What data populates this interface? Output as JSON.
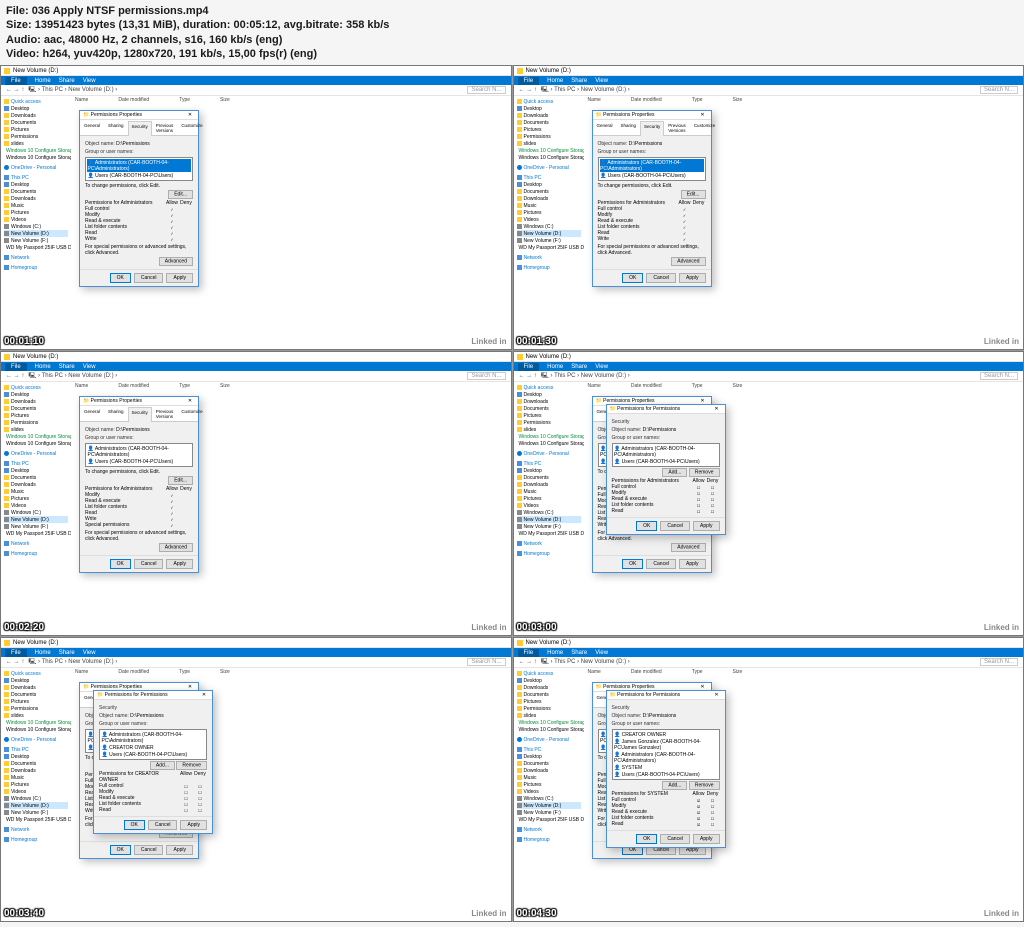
{
  "header": {
    "file_label": "File:",
    "file": "036 Apply NTSF permissions.mp4",
    "size_label": "Size:",
    "size": "13951423 bytes (13,31 MiB),",
    "dur_label": "duration:",
    "duration": "00:05:12,",
    "br_label": "avg.bitrate:",
    "bitrate": "358 kb/s",
    "audio_label": "Audio:",
    "audio": "aac, 48000 Hz, 2 channels, s16, 160 kb/s (eng)",
    "video_label": "Video:",
    "video": "h264, yuv420p, 1280x720, 191 kb/s, 15,00 fps(r) (eng)"
  },
  "explorer": {
    "title": "New Volume (D:)",
    "toolbar": {
      "file": "File",
      "home": "Home",
      "share": "Share",
      "view": "View"
    },
    "path": {
      "prefix": "This PC",
      "loc": "New Volume (D:)",
      "search": "Search N..."
    },
    "cols": {
      "name": "Name",
      "modified": "Date modified",
      "type": "Type",
      "size": "Size"
    },
    "sidebar": [
      {
        "t": "Quick access",
        "c": "blue"
      },
      {
        "t": "Desktop"
      },
      {
        "t": "Downloads"
      },
      {
        "t": "Documents"
      },
      {
        "t": "Pictures"
      },
      {
        "t": "Permissions",
        "c": ""
      },
      {
        "t": "slides"
      },
      {
        "t": "Windows 10 Configure Storage",
        "c": "green"
      },
      {
        "t": "Windows 10 Configure Storage"
      },
      {
        "t": ""
      },
      {
        "t": "OneDrive - Personal",
        "c": "blue"
      },
      {
        "t": ""
      },
      {
        "t": "This PC",
        "c": "blue"
      },
      {
        "t": "Desktop"
      },
      {
        "t": "Documents"
      },
      {
        "t": "Downloads"
      },
      {
        "t": "Music"
      },
      {
        "t": "Pictures"
      },
      {
        "t": "Videos"
      },
      {
        "t": "Windows (C:)"
      },
      {
        "t": "New Volume (D:)",
        "sel": true
      },
      {
        "t": "New Volume (F:)"
      },
      {
        "t": "WD My Passport 25IF USB Device (G:)"
      },
      {
        "t": ""
      },
      {
        "t": "Network",
        "c": "blue"
      },
      {
        "t": ""
      },
      {
        "t": "Homegroup",
        "c": "blue"
      }
    ]
  },
  "propsDialog": {
    "title": "Permissions Properties",
    "tabs": [
      "General",
      "Sharing",
      "Security",
      "Previous Versions",
      "Customize"
    ],
    "objname_l": "Object name:",
    "objname": "D:\\Permissions",
    "group_l": "Group or user names:",
    "users": [
      "Administrators (CAR-BOOTH-04-PC\\Administrators)",
      "Users (CAR-BOOTH-04-PC\\Users)"
    ],
    "change_l": "To change permissions, click Edit.",
    "edit": "Edit...",
    "perms_l": "Permissions for Administrators",
    "allow": "Allow",
    "deny": "Deny",
    "perms1": [
      "Full control",
      "Modify",
      "Read & execute",
      "List folder contents",
      "Read",
      "Write"
    ],
    "perms2": [
      "Modify",
      "Read & execute",
      "List folder contents",
      "Read",
      "Write",
      "Special permissions"
    ],
    "adv_l": "For special permissions or advanced settings, click Advanced.",
    "adv": "Advanced",
    "ok": "OK",
    "cancel": "Cancel",
    "apply": "Apply"
  },
  "permForDialog": {
    "title": "Permissions for Permissions",
    "sec": "Security",
    "objname_l": "Object name:",
    "objname": "D:\\Permissions",
    "group_l": "Group or user names:",
    "users4": [
      "Administrators (CAR-BOOTH-04-PC\\Administrators)",
      "Users (CAR-BOOTH-04-PC\\Users)"
    ],
    "users5": [
      "Administrators (CAR-BOOTH-04-PC\\Administrators)",
      "CREATOR OWNER",
      "Users (CAR-BOOTH-04-PC\\Users)"
    ],
    "users6": [
      "CREATOR OWNER",
      "James Gonzalez (CAR-BOOTH-04-PC\\James Gonzalez)",
      "Administrators (CAR-BOOTH-04-PC\\Administrators)",
      "SYSTEM",
      "Users (CAR-BOOTH-04-PC\\Users)"
    ],
    "add": "Add...",
    "remove": "Remove",
    "perms_l4": "Permissions for Administrators",
    "perms_l5": "Permissions for CREATOR OWNER",
    "perms_l6": "Permissions for SYSTEM",
    "allow": "Allow",
    "deny": "Deny",
    "perms": [
      "Full control",
      "Modify",
      "Read & execute",
      "List folder contents",
      "Read"
    ],
    "ok": "OK",
    "cancel": "Cancel",
    "apply": "Apply"
  },
  "timestamps": [
    "00:01:10",
    "00:01:30",
    "00:02:20",
    "00:03:00",
    "00:03:40",
    "00:04:30"
  ],
  "linkedin": "Linked in"
}
